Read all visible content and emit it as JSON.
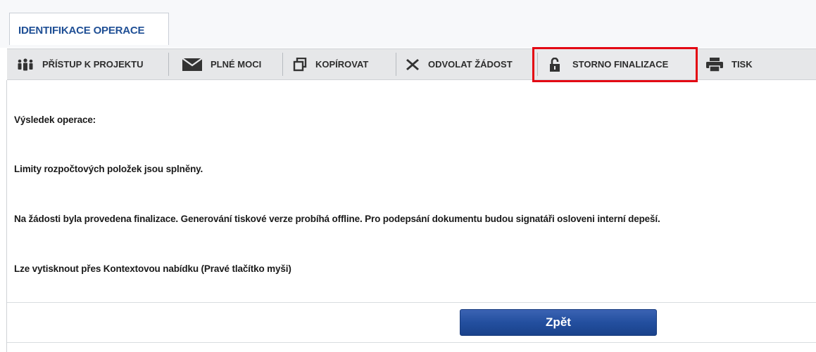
{
  "tab": {
    "label": "IDENTIFIKACE OPERACE"
  },
  "toolbar": {
    "items": [
      {
        "label": "PŘÍSTUP K PROJEKTU",
        "icon": "people-icon"
      },
      {
        "label": "PLNÉ MOCI",
        "icon": "envelope-icon"
      },
      {
        "label": "KOPÍROVAT",
        "icon": "copy-icon"
      },
      {
        "label": "ODVOLAT ŽÁDOST",
        "icon": "x-icon"
      },
      {
        "label": "STORNO FINALIZACE",
        "icon": "unlock-icon"
      },
      {
        "label": "TISK",
        "icon": "printer-icon"
      }
    ],
    "highlighted_item": "STORNO FINALIZACE",
    "highlight_color": "#e30613"
  },
  "messages": {
    "heading": "Výsledek operace:",
    "line1": "Limity rozpočtových položek jsou splněny.",
    "line2": "Na žádosti byla provedena finalizace. Generování tiskové verze probíhá offline. Pro podepsání dokumentu budou signatáři osloveni interní depeší.",
    "line3": "Lze vytisknout přes Kontextovou nabídku (Pravé tlačítko myši)"
  },
  "actions": {
    "back_label": "Zpět"
  },
  "colors": {
    "tab_text": "#1f4f95",
    "button_bg": "#234f9f",
    "toolbar_bg": "#e6e7e9"
  }
}
